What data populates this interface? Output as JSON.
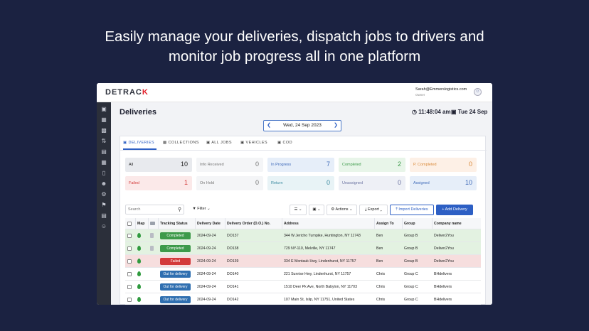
{
  "headline": {
    "line1": "Easily manage your deliveries, dispatch jobs to drivers and",
    "line2": "monitor job progress all in one platform"
  },
  "app": {
    "logo_main": "DETRAC",
    "logo_accent": "K",
    "user_email": "Sarah@Emmerslogistics.com",
    "user_role": "Owner",
    "avatar_icon": "user-circle-icon"
  },
  "sidebar": {
    "icons": [
      "truck-icon",
      "map-icon",
      "briefcase-icon",
      "route-icon",
      "clipboard-icon",
      "dashboard-icon",
      "book-icon",
      "users-icon",
      "settings-icon",
      "flag-icon",
      "report-icon",
      "person-icon"
    ]
  },
  "page": {
    "title": "Deliveries",
    "time": "11:48:04 am",
    "date": "Tue 24 Sep",
    "date_picker": "Wed, 24 Sep 2023"
  },
  "tabs": [
    {
      "label": "DELIVERIES",
      "icon": "truck-icon",
      "active": true
    },
    {
      "label": "COLLECTIONS",
      "icon": "box-icon",
      "active": false
    },
    {
      "label": "ALL JOBS",
      "icon": "truck-icon",
      "active": false
    },
    {
      "label": "VEHICLES",
      "icon": "car-icon",
      "active": false
    },
    {
      "label": "COD",
      "icon": "car-icon",
      "active": false
    }
  ],
  "status_counts": [
    {
      "label": "All",
      "count": "10",
      "bg": "#e8eaee",
      "color": "#222222"
    },
    {
      "label": "Info Received",
      "count": "0",
      "bg": "#f4f5f7",
      "color": "#777777"
    },
    {
      "label": "In Progress",
      "count": "7",
      "bg": "#e6eef9",
      "color": "#3d69b8"
    },
    {
      "label": "Completed",
      "count": "2",
      "bg": "#e8f5e9",
      "color": "#3d9a4a"
    },
    {
      "label": "P. Completed",
      "count": "0",
      "bg": "#fdf0e6",
      "color": "#d98a3a"
    },
    {
      "label": "Failed",
      "count": "1",
      "bg": "#fbe9e9",
      "color": "#d33a3a"
    },
    {
      "label": "On Hold",
      "count": "0",
      "bg": "#f4f5f7",
      "color": "#777777"
    },
    {
      "label": "Return",
      "count": "0",
      "bg": "#e8f3f6",
      "color": "#3a8aa0"
    },
    {
      "label": "Unassigned",
      "count": "0",
      "bg": "#eef0f6",
      "color": "#6a72a0"
    },
    {
      "label": "Assigned",
      "count": "10",
      "bg": "#e6eef9",
      "color": "#3d69b8"
    }
  ],
  "toolbar": {
    "search_placeholder": "Search",
    "filter": "Filter",
    "actions": "Actions",
    "export": "Export",
    "import": "Import Deliveries",
    "add": "+ Add Delivery"
  },
  "table": {
    "headers": {
      "map": "Map",
      "tracking_status": "Tracking Status",
      "delivery_date": "Delivery Date",
      "delivery_order": "Delivery Order (D.O.) No.",
      "address": "Address",
      "assign_to": "Assign To",
      "group": "Group",
      "company": "Company name"
    },
    "rows": [
      {
        "status": "Completed",
        "status_color": "#3d9a4a",
        "row_bg": "#e3f2e1",
        "date": "2024-09-24",
        "do": "DO137",
        "address": "344 W Jericho Turnpike, Huntington, NY 11743",
        "assign": "Ben",
        "group": "Group B",
        "company": "Deliver2You"
      },
      {
        "status": "Completed",
        "status_color": "#3d9a4a",
        "row_bg": "#e3f2e1",
        "date": "2024-09-24",
        "do": "DO138",
        "address": "729 NY-110, Melville, NY 11747",
        "assign": "Ben",
        "group": "Group B",
        "company": "Deliver2You"
      },
      {
        "status": "Failed",
        "status_color": "#d33a3a",
        "row_bg": "#f6dede",
        "date": "2024-09-24",
        "do": "DO139",
        "address": "334 E Montauk Hwy, Lindenhurst, NY 11757",
        "assign": "Ben",
        "group": "Group B",
        "company": "Deliver2You"
      },
      {
        "status": "Out for delivery",
        "status_color": "#2f6fb0",
        "row_bg": "#ffffff",
        "date": "2024-09-24",
        "do": "DO140",
        "address": "221 Sunrise Hwy, Lindenhurst, NY 11757",
        "assign": "Chris",
        "group": "Group C",
        "company": "BHdelivers"
      },
      {
        "status": "Out for delivery",
        "status_color": "#2f6fb0",
        "row_bg": "#ffffff",
        "date": "2024-09-24",
        "do": "DO141",
        "address": "1510 Deer Pk Ave, North Babylon, NY 11703",
        "assign": "Chris",
        "group": "Group C",
        "company": "BHdelivers"
      },
      {
        "status": "Out for delivery",
        "status_color": "#2f6fb0",
        "row_bg": "#ffffff",
        "date": "2024-09-24",
        "do": "DO142",
        "address": "107 Main St, Islip, NY 11751, United States",
        "assign": "Chris",
        "group": "Group C",
        "company": "BHdelivers"
      }
    ]
  }
}
